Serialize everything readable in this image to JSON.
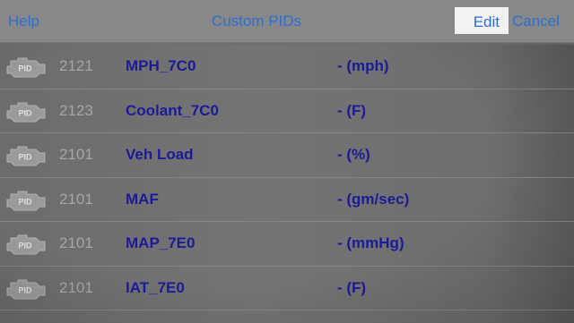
{
  "navbar": {
    "help_label": "Help",
    "title": "Custom PIDs",
    "edit_label": "Edit",
    "cancel_label": "Cancel"
  },
  "rows": [
    {
      "icon_text": "PID",
      "pid": "2121",
      "name": "MPH_7C0",
      "unit": "- (mph)"
    },
    {
      "icon_text": "PID",
      "pid": "2123",
      "name": "Coolant_7C0",
      "unit": "- (F)"
    },
    {
      "icon_text": "PID",
      "pid": "2101",
      "name": "Veh Load",
      "unit": "- (%)"
    },
    {
      "icon_text": "PID",
      "pid": "2101",
      "name": "MAF",
      "unit": "- (gm/sec)"
    },
    {
      "icon_text": "PID",
      "pid": "2101",
      "name": "MAP_7E0",
      "unit": "- (mmHg)"
    },
    {
      "icon_text": "PID",
      "pid": "2101",
      "name": "IAT_7E0",
      "unit": "- (F)"
    }
  ],
  "colors": {
    "link": "#2b6fd0",
    "row_text": "#1b1b9a",
    "pid_number": "#a6a6a6",
    "background": "#6f6f6f"
  },
  "icons": {
    "row": "engine-pid-icon"
  }
}
